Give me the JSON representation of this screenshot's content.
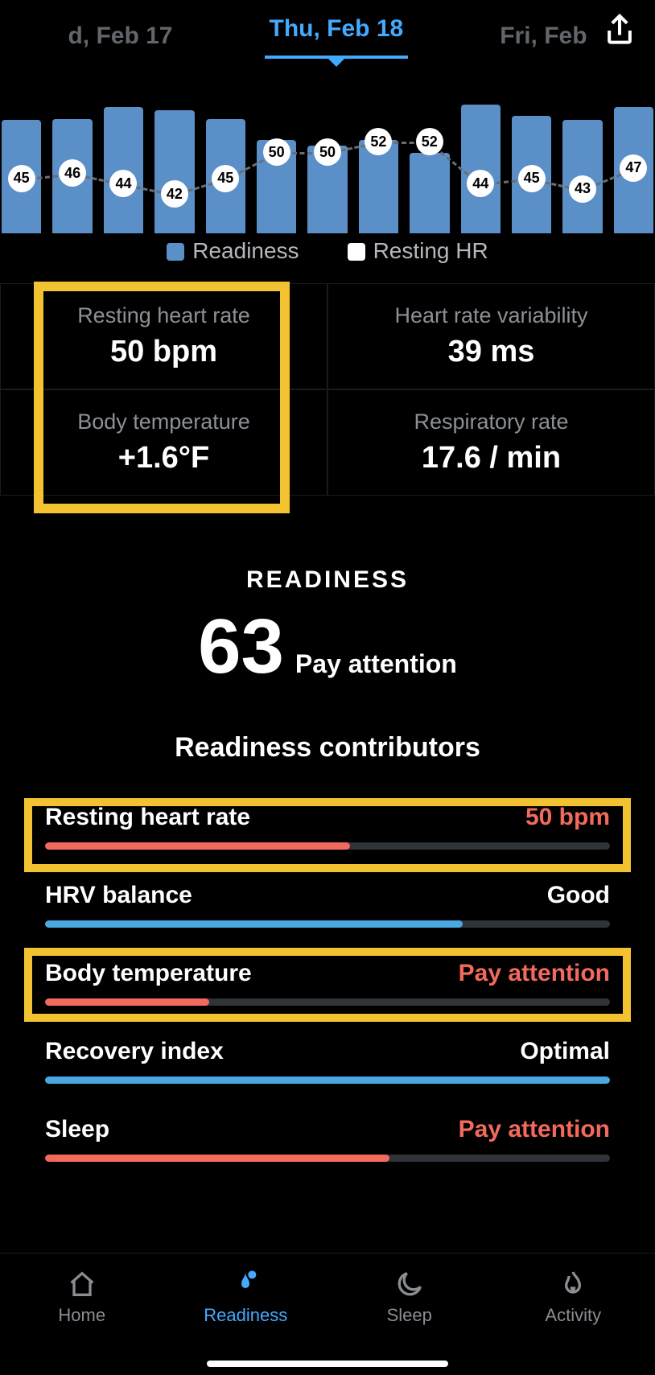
{
  "dates": {
    "prev": "d, Feb 17",
    "current": "Thu, Feb 18",
    "next": "Fri, Feb"
  },
  "chart_data": {
    "type": "bar",
    "series": [
      {
        "name": "Readiness",
        "values": [
          79,
          80,
          88,
          86,
          80,
          65,
          61,
          65,
          56,
          90,
          82,
          79,
          88
        ]
      },
      {
        "name": "Resting HR",
        "values": [
          45,
          46,
          44,
          42,
          45,
          50,
          50,
          52,
          52,
          44,
          45,
          43,
          47
        ]
      }
    ],
    "ylabel": "",
    "xlabel": "",
    "ylim": [
      0,
      100
    ],
    "legend": {
      "readiness": "Readiness",
      "resting_hr": "Resting HR"
    }
  },
  "stats": {
    "rhr": {
      "label": "Resting heart rate",
      "value": "50 bpm"
    },
    "hrv": {
      "label": "Heart rate variability",
      "value": "39 ms"
    },
    "temp": {
      "label": "Body temperature",
      "value": "+1.6°F"
    },
    "resp": {
      "label": "Respiratory rate",
      "value": "17.6 / min"
    }
  },
  "score": {
    "title": "READINESS",
    "value": "63",
    "status": "Pay attention"
  },
  "contributors": {
    "title": "Readiness contributors",
    "rows": [
      {
        "label": "Resting heart rate",
        "value": "50 bpm",
        "tone": "warn",
        "pct": 54
      },
      {
        "label": "HRV balance",
        "value": "Good",
        "tone": "good",
        "pct": 74
      },
      {
        "label": "Body temperature",
        "value": "Pay attention",
        "tone": "warn",
        "pct": 29
      },
      {
        "label": "Recovery index",
        "value": "Optimal",
        "tone": "good",
        "pct": 100
      },
      {
        "label": "Sleep",
        "value": "Pay attention",
        "tone": "warn",
        "pct": 61
      }
    ]
  },
  "tabs": {
    "home": "Home",
    "readiness": "Readiness",
    "sleep": "Sleep",
    "activity": "Activity"
  }
}
